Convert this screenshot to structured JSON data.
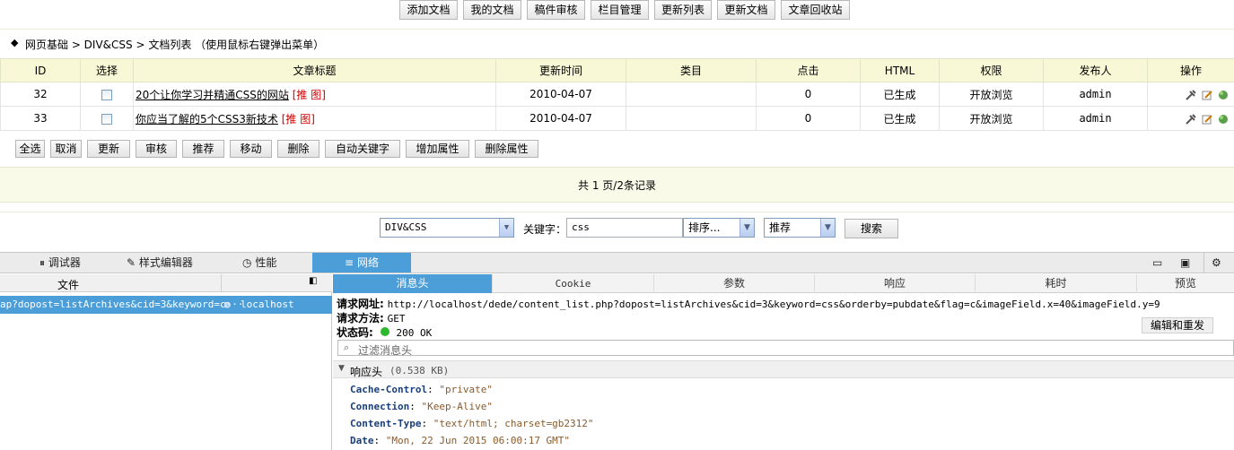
{
  "toolbar": {
    "buttons": [
      "添加文档",
      "我的文档",
      "稿件审核",
      "栏目管理",
      "更新列表",
      "更新文档",
      "文章回收站"
    ]
  },
  "breadcrumb": {
    "text": "网页基础 > DIV&CSS > 文档列表 （使用鼠标右键弹出菜单）"
  },
  "table": {
    "headers": [
      "ID",
      "选择",
      "文章标题",
      "更新时间",
      "类目",
      "点击",
      "HTML",
      "权限",
      "发布人",
      "操作"
    ],
    "rows": [
      {
        "id": "32",
        "title": "20个让你学习并精通CSS的网站",
        "flags": "[推 图]",
        "date": "2010-04-07",
        "category": "",
        "clicks": "0",
        "html": "已生成",
        "perm": "开放浏览",
        "author": "admin"
      },
      {
        "id": "33",
        "title": "你应当了解的5个CSS3新技术",
        "flags": "[推 图]",
        "date": "2010-04-07",
        "category": "",
        "clicks": "0",
        "html": "已生成",
        "perm": "开放浏览",
        "author": "admin"
      }
    ]
  },
  "actions": [
    "全选",
    "取消",
    "更新",
    "审核",
    "推荐",
    "移动",
    "删除",
    "自动关键字",
    "增加属性",
    "删除属性"
  ],
  "pager": {
    "text": "共 1 页/2条记录"
  },
  "search": {
    "category": "DIV&CSS",
    "keyword_label": "关键字：",
    "keyword_value": "css",
    "order": "排序...",
    "flag": "推荐",
    "submit": "搜索"
  },
  "devtools": {
    "tabs": [
      "调试器",
      "样式编辑器",
      "性能",
      "网络"
    ],
    "file_header": "文件",
    "request_row": {
      "file": "ap?dopost=listArchives&cid=3&keyword=c···",
      "domain": "localhost"
    },
    "sub_tabs": [
      "消息头",
      "Cookie",
      "参数",
      "响应",
      "耗时",
      "预览"
    ],
    "request_url_label": "请求网址:",
    "request_url": "http://localhost/dede/content_list.php?dopost=listArchives&cid=3&keyword=css&orderby=pubdate&flag=c&imageField.x=40&imageField.y=9",
    "method_label": "请求方法:",
    "method": "GET",
    "status_label": "状态码:",
    "status": "200 OK",
    "edit_resend": "编辑和重发",
    "filter_placeholder": "过滤消息头",
    "response_headers_title": "响应头",
    "response_headers_size": "(0.538 KB)",
    "headers": [
      {
        "key": "Cache-Control",
        "value": "\"private\""
      },
      {
        "key": "Connection",
        "value": "\"Keep-Alive\""
      },
      {
        "key": "Content-Type",
        "value": "\"text/html; charset=gb2312\""
      },
      {
        "key": "Date",
        "value": "\"Mon, 22 Jun 2015 06:00:17 GMT\""
      }
    ]
  },
  "colors": {
    "accent": "#4c9ed9",
    "header_bg": "#f8f8d6",
    "flag_red": "#cc0000"
  }
}
